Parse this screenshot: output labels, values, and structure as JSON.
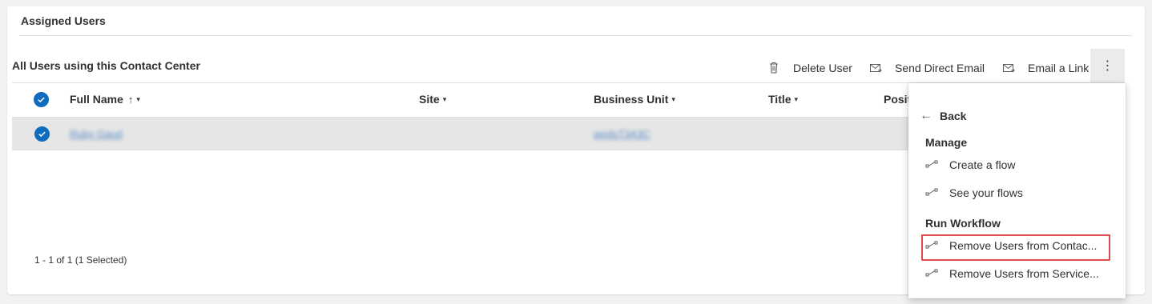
{
  "section": {
    "title": "Assigned Users"
  },
  "grid": {
    "title": "All Users using this Contact Center",
    "commands": {
      "delete_user": "Delete User",
      "send_direct_email": "Send Direct Email",
      "email_link": "Email a Link",
      "more": "⋮"
    },
    "columns": {
      "full_name": "Full Name",
      "site": "Site",
      "business_unit": "Business Unit",
      "title": "Title",
      "position": "Positio"
    },
    "rows": [
      {
        "full_name": "Ruby Gaud",
        "site": "",
        "business_unit": "wodsT3A3C",
        "title": ""
      }
    ],
    "footer": {
      "count": "1 - 1 of 1 (1 Selected)"
    }
  },
  "menu": {
    "back": "Back",
    "manage_heading": "Manage",
    "manage_items": [
      "Create a flow",
      "See your flows"
    ],
    "workflow_heading": "Run Workflow",
    "workflow_items": [
      "Remove Users from Contac...",
      "Remove Users from Service..."
    ]
  },
  "colors": {
    "accent": "#0f6cbd",
    "highlight": "#e04a4a",
    "selected_row": "#e6e6e6"
  },
  "icons": {
    "delete": "trash-icon",
    "email": "email-icon",
    "link": "email-link-icon",
    "flow": "flow-icon",
    "back": "back-arrow-icon"
  }
}
